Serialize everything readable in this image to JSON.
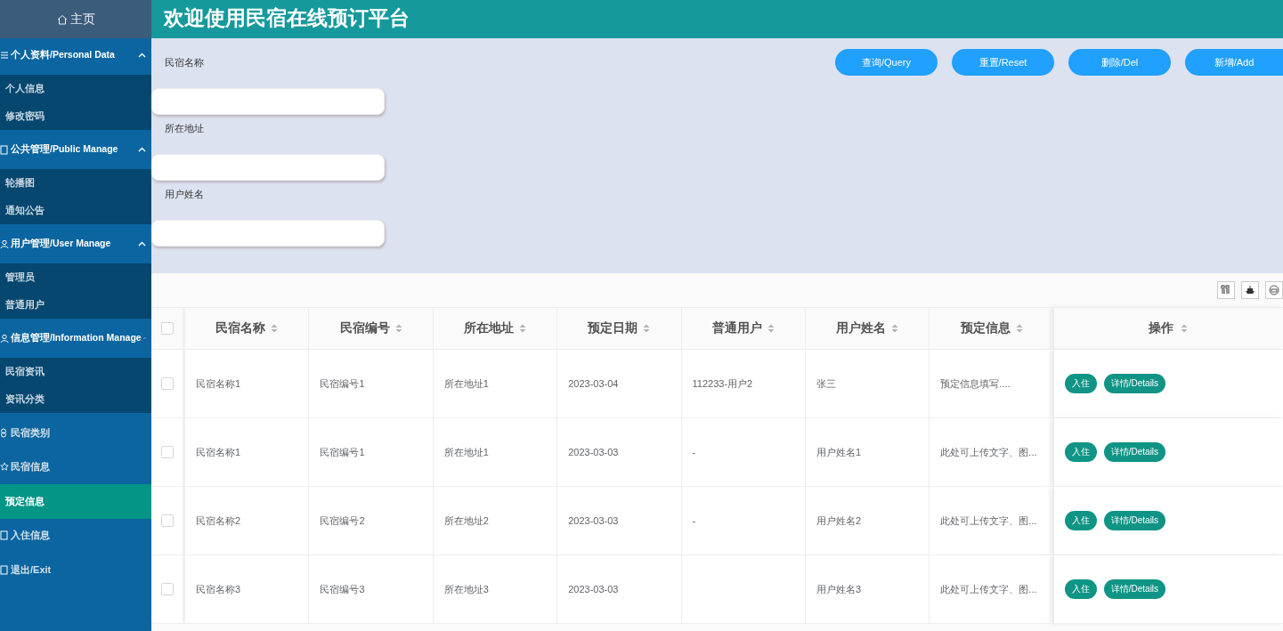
{
  "header": {
    "title": "欢迎使用民宿在线预订平台"
  },
  "sidebar": {
    "home": {
      "label": "主页"
    },
    "menu": [
      {
        "kind": "group",
        "label": "个人资料/Personal Data",
        "expanded": true,
        "children": [
          {
            "label": "个人信息",
            "selected": false
          },
          {
            "label": "修改密码",
            "selected": false
          }
        ]
      },
      {
        "kind": "group",
        "label": "公共管理/Public Manage",
        "expanded": true,
        "children": [
          {
            "label": "轮播图",
            "selected": false
          },
          {
            "label": "通知公告",
            "selected": false
          }
        ]
      },
      {
        "kind": "group",
        "label": "用户管理/User Manage",
        "expanded": true,
        "children": [
          {
            "label": "管理员",
            "selected": false
          },
          {
            "label": "普通用户",
            "selected": false
          }
        ]
      },
      {
        "kind": "group",
        "label": "信息管理/Information Manage",
        "expanded": true,
        "children": [
          {
            "label": "民宿资讯",
            "selected": false
          },
          {
            "label": "资讯分类",
            "selected": false
          }
        ]
      },
      {
        "kind": "item",
        "label": "民宿类别",
        "selected": false
      },
      {
        "kind": "item",
        "label": "民宿信息",
        "selected": false
      },
      {
        "kind": "item",
        "label": "预定信息",
        "selected": true
      },
      {
        "kind": "item",
        "label": "入住信息",
        "selected": false
      },
      {
        "kind": "item",
        "label": "退出/Exit",
        "selected": false
      }
    ]
  },
  "search": {
    "fields": [
      {
        "label": "民宿名称"
      },
      {
        "label": "所在地址"
      },
      {
        "label": "用户姓名"
      }
    ],
    "buttons": [
      "查询/Query",
      "重置/Reset",
      "删除/Del",
      "新增/Add"
    ]
  },
  "toolbar": {
    "tools": [
      {
        "kind": "columns"
      },
      {
        "kind": "export"
      },
      {
        "kind": "print"
      }
    ]
  },
  "table": {
    "select_all": {
      "checked": false
    },
    "columns": [
      "民宿名称",
      "民宿编号",
      "所在地址",
      "预定日期",
      "普通用户",
      "用户姓名",
      "预定信息",
      "操作"
    ],
    "rows": [
      {
        "checked": false,
        "cells": [
          "民宿名称1",
          "民宿编号1",
          "所在地址1",
          "2023-03-04",
          "112233-用户2",
          "张三",
          "预定信息填写...."
        ],
        "actions": [
          "入住",
          "详情/Details"
        ]
      },
      {
        "checked": false,
        "cells": [
          "民宿名称1",
          "民宿编号1",
          "所在地址1",
          "2023-03-03",
          "-",
          "用户姓名1",
          "此处可上传文字、图..."
        ],
        "actions": [
          "入住",
          "详情/Details"
        ]
      },
      {
        "checked": false,
        "cells": [
          "民宿名称2",
          "民宿编号2",
          "所在地址2",
          "2023-03-03",
          "-",
          "用户姓名2",
          "此处可上传文字、图..."
        ],
        "actions": [
          "入住",
          "详情/Details"
        ]
      },
      {
        "checked": false,
        "cells": [
          "民宿名称3",
          "民宿编号3",
          "所在地址3",
          "2023-03-03",
          null,
          "用户姓名3",
          "此处可上传文字、图..."
        ],
        "actions": [
          "入住",
          "详情/Details"
        ]
      }
    ]
  }
}
